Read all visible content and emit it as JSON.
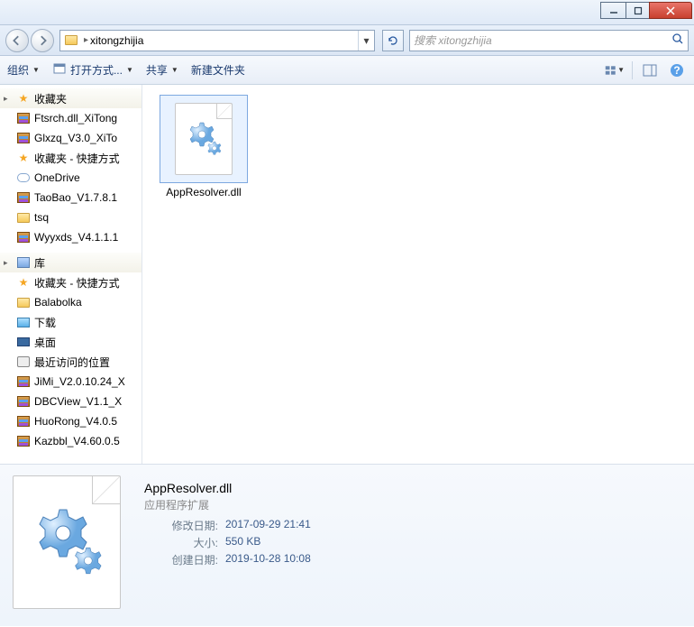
{
  "address": {
    "folder_name": "xitongzhijia"
  },
  "search": {
    "placeholder": "搜索 xitongzhijia"
  },
  "toolbar": {
    "organize": "组织",
    "open_with": "打开方式...",
    "share": "共享",
    "new_folder": "新建文件夹"
  },
  "sidebar": {
    "favorites_header": "收藏夹",
    "items_fav": [
      "Ftsrch.dll_XiTong",
      "Glxzq_V3.0_XiTo",
      "收藏夹 - 快捷方式",
      "OneDrive",
      "TaoBao_V1.7.8.1",
      "tsq",
      "Wyyxds_V4.1.1.1"
    ],
    "libraries_header": "库",
    "items_lib": [
      "收藏夹 - 快捷方式",
      "Balabolka",
      "下载",
      "桌面",
      "最近访问的位置",
      "JiMi_V2.0.10.24_X",
      "DBCView_V1.1_X",
      "HuoRong_V4.0.5",
      "Kazbbl_V4.60.0.5"
    ]
  },
  "content": {
    "file_name": "AppResolver.dll"
  },
  "details": {
    "title": "AppResolver.dll",
    "type": "应用程序扩展",
    "modified_label": "修改日期:",
    "modified_value": "2017-09-29 21:41",
    "size_label": "大小:",
    "size_value": "550 KB",
    "created_label": "创建日期:",
    "created_value": "2019-10-28 10:08"
  }
}
